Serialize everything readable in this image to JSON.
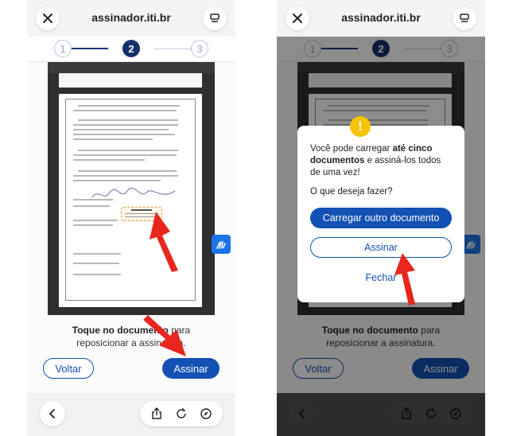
{
  "browser": {
    "url": "assinador.iti.br"
  },
  "stepper": {
    "steps": [
      "1",
      "2",
      "3"
    ],
    "active_step": 2
  },
  "left_screen": {
    "instruction": {
      "bold": "Toque no documento",
      "rest": " para reposicionar a assinatura."
    },
    "voltar_label": "Voltar",
    "assinar_label": "Assinar",
    "signature_placeholder": "Área de assinatura"
  },
  "right_screen": {
    "instruction": {
      "bold": "Toque no documento",
      "rest": " para reposicionar a assinatura."
    },
    "voltar_label": "Voltar",
    "assinar_label": "Assinar",
    "modal": {
      "msg_pre": "Você pode carregar ",
      "msg_bold": "até cinco documentos",
      "msg_post": " e assiná-los todos de uma vez!",
      "question": "O que deseja fazer?",
      "upload_label": "Carregar outro documento",
      "assinar_label": "Assinar",
      "fechar_label": "Fechar"
    }
  },
  "colors": {
    "primary": "#1351b4",
    "annotation_arrow": "#e8261f",
    "warning": "#f5c400"
  },
  "icons": [
    "close-icon",
    "tabs-icon",
    "back-chevron-icon",
    "share-icon",
    "reload-icon",
    "compass-icon",
    "sign-language-icon",
    "warning-icon",
    "annotation-arrow"
  ]
}
